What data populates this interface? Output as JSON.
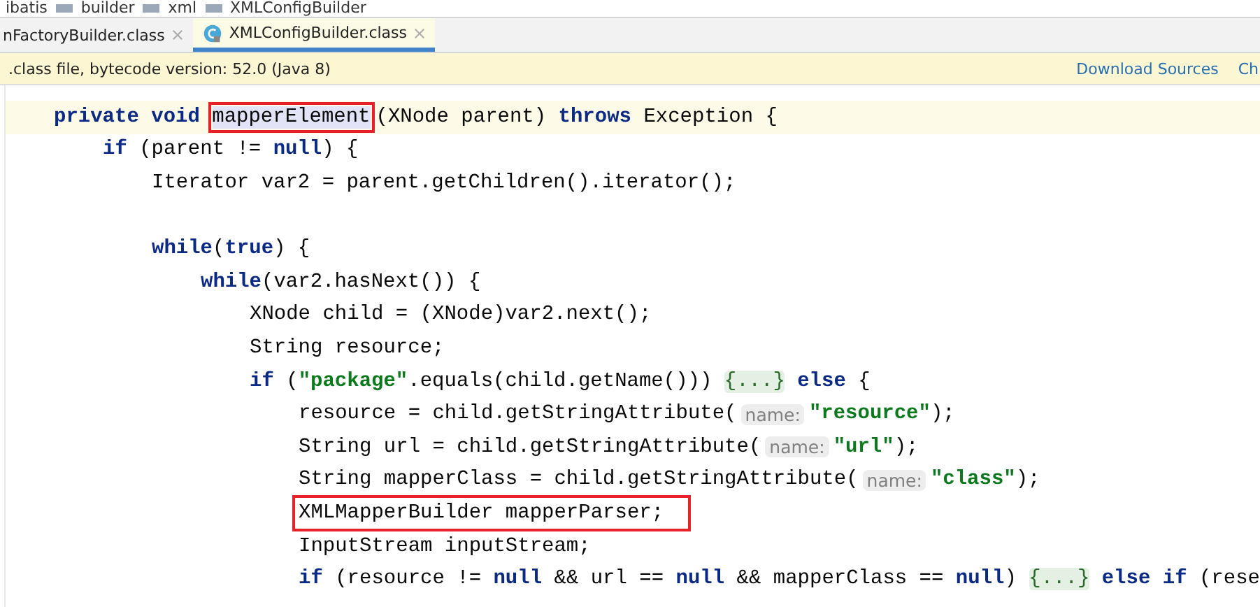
{
  "breadcrumb": [
    "ibatis",
    "builder",
    "xml",
    "XMLConfigBuilder"
  ],
  "tabs": [
    {
      "label": "nFactoryBuilder.class",
      "selected": false,
      "icon": false
    },
    {
      "label": "XMLConfigBuilder.class",
      "selected": true,
      "icon": true
    }
  ],
  "notice": {
    "text": ".class file, bytecode version: 52.0 (Java 8)",
    "links": [
      "Download Sources",
      "Ch"
    ]
  },
  "code": [
    {
      "current": true,
      "boxed": false,
      "gap_before": false,
      "tokens": [
        {
          "kind": "kw",
          "text": "private void "
        },
        {
          "kind": "plain",
          "text": "mapperElement",
          "boxed": true,
          "highlighted": true
        },
        {
          "kind": "plain",
          "text": "(XNode parent) "
        },
        {
          "kind": "kw",
          "text": "throws "
        },
        {
          "kind": "plain",
          "text": "Exception {"
        }
      ],
      "children": [
        {
          "current": false,
          "boxed": false,
          "gap_before": false,
          "tokens": [
            {
              "kind": "kw",
              "text": "if "
            },
            {
              "kind": "plain",
              "text": "(parent != "
            },
            {
              "kind": "kw",
              "text": "null"
            },
            {
              "kind": "plain",
              "text": ") {"
            }
          ],
          "children": [
            {
              "current": false,
              "boxed": false,
              "gap_before": false,
              "tokens": [
                {
                  "kind": "plain",
                  "text": "Iterator var2 = parent.getChildren().iterator();"
                }
              ]
            },
            {
              "current": false,
              "boxed": false,
              "gap_before": true,
              "tokens": [
                {
                  "kind": "kw",
                  "text": "while"
                },
                {
                  "kind": "plain",
                  "text": "("
                },
                {
                  "kind": "kw",
                  "text": "true"
                },
                {
                  "kind": "plain",
                  "text": ") {"
                }
              ],
              "children": [
                {
                  "current": false,
                  "boxed": false,
                  "gap_before": false,
                  "tokens": [
                    {
                      "kind": "kw",
                      "text": "while"
                    },
                    {
                      "kind": "plain",
                      "text": "(var2.hasNext()) {"
                    }
                  ],
                  "children": [
                    {
                      "current": false,
                      "boxed": false,
                      "gap_before": false,
                      "tokens": [
                        {
                          "kind": "plain",
                          "text": "XNode child = (XNode)var2.next();"
                        }
                      ]
                    },
                    {
                      "current": false,
                      "boxed": false,
                      "gap_before": false,
                      "tokens": [
                        {
                          "kind": "plain",
                          "text": "String resource;"
                        }
                      ]
                    },
                    {
                      "current": false,
                      "boxed": false,
                      "gap_before": false,
                      "tokens": [
                        {
                          "kind": "kw",
                          "text": "if "
                        },
                        {
                          "kind": "plain",
                          "text": "("
                        },
                        {
                          "kind": "str",
                          "text": "\"package\""
                        },
                        {
                          "kind": "plain",
                          "text": ".equals(child.getName())) "
                        },
                        {
                          "kind": "fold",
                          "text": "{...}"
                        },
                        {
                          "kind": "kw",
                          "text": " else "
                        },
                        {
                          "kind": "plain",
                          "text": "{"
                        }
                      ],
                      "children": [
                        {
                          "current": false,
                          "boxed": false,
                          "gap_before": false,
                          "tokens": [
                            {
                              "kind": "plain",
                              "text": "resource = child.getStringAttribute("
                            },
                            {
                              "kind": "hint",
                              "text": "name:"
                            },
                            {
                              "kind": "str",
                              "text": "\"resource\""
                            },
                            {
                              "kind": "plain",
                              "text": ");"
                            }
                          ]
                        },
                        {
                          "current": false,
                          "boxed": false,
                          "gap_before": false,
                          "tokens": [
                            {
                              "kind": "plain",
                              "text": "String url = child.getStringAttribute("
                            },
                            {
                              "kind": "hint",
                              "text": "name:"
                            },
                            {
                              "kind": "str",
                              "text": "\"url\""
                            },
                            {
                              "kind": "plain",
                              "text": ");"
                            }
                          ]
                        },
                        {
                          "current": false,
                          "boxed": false,
                          "gap_before": false,
                          "tokens": [
                            {
                              "kind": "plain",
                              "text": "String mapperClass = child.getStringAttribute("
                            },
                            {
                              "kind": "hint",
                              "text": "name:"
                            },
                            {
                              "kind": "str",
                              "text": "\"class\""
                            },
                            {
                              "kind": "plain",
                              "text": ");"
                            }
                          ]
                        },
                        {
                          "current": false,
                          "boxed": true,
                          "gap_before": false,
                          "tokens": [
                            {
                              "kind": "plain",
                              "text": "XMLMapperBuilder mapperParser;"
                            }
                          ]
                        },
                        {
                          "current": false,
                          "boxed": false,
                          "gap_before": false,
                          "tokens": [
                            {
                              "kind": "plain",
                              "text": "InputStream inputStream;"
                            }
                          ]
                        },
                        {
                          "current": false,
                          "boxed": false,
                          "gap_before": false,
                          "tokens": [
                            {
                              "kind": "kw",
                              "text": "if "
                            },
                            {
                              "kind": "plain",
                              "text": "(resource != "
                            },
                            {
                              "kind": "kw",
                              "text": "null "
                            },
                            {
                              "kind": "plain",
                              "text": "&& url == "
                            },
                            {
                              "kind": "kw",
                              "text": "null "
                            },
                            {
                              "kind": "plain",
                              "text": "&& mapperClass == "
                            },
                            {
                              "kind": "kw",
                              "text": "null"
                            },
                            {
                              "kind": "plain",
                              "text": ") "
                            },
                            {
                              "kind": "fold",
                              "text": "{...}"
                            },
                            {
                              "kind": "kw",
                              "text": " else if "
                            },
                            {
                              "kind": "plain",
                              "text": "(rese"
                            }
                          ]
                        }
                      ]
                    }
                  ]
                }
              ]
            }
          ]
        }
      ]
    }
  ]
}
